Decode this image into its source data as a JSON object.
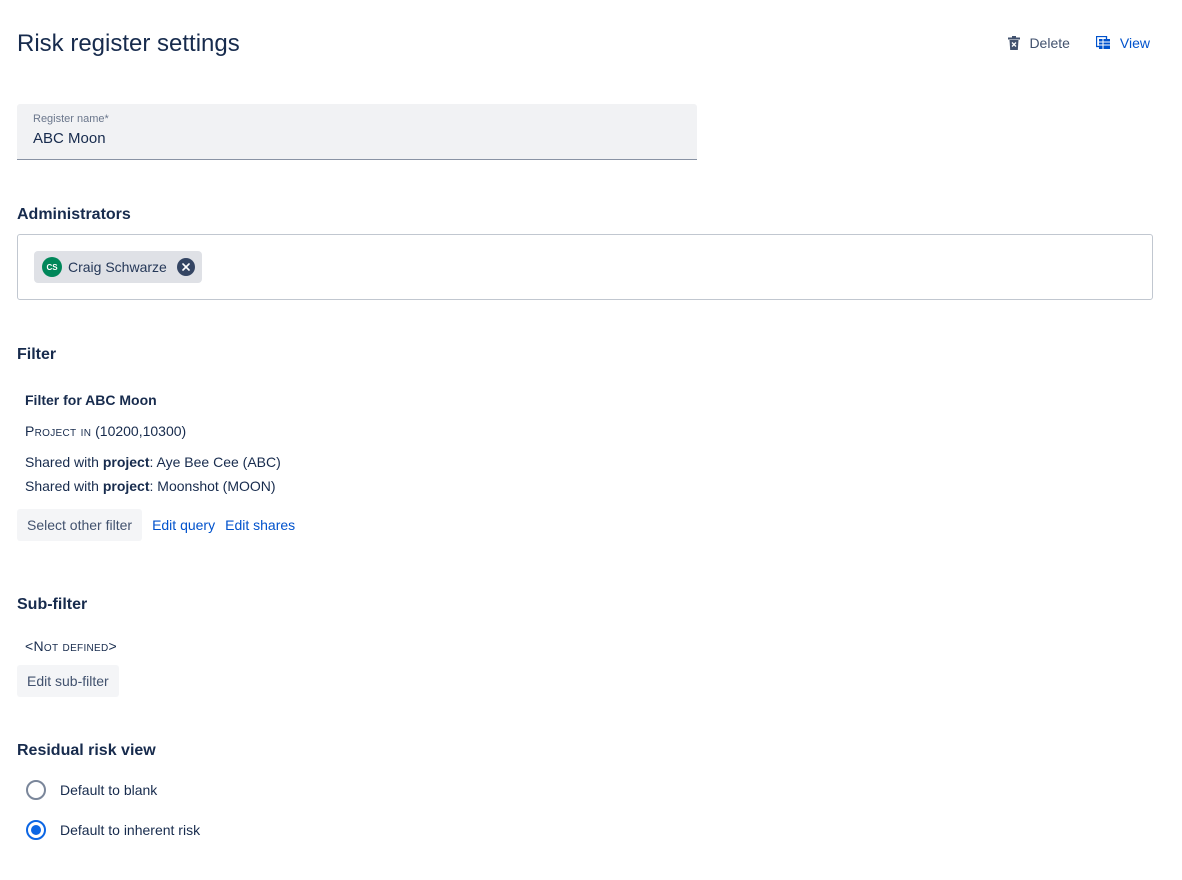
{
  "header": {
    "title": "Risk register settings",
    "delete_label": "Delete",
    "view_label": "View"
  },
  "register_name": {
    "label": "Register name*",
    "value": "ABC Moon"
  },
  "administrators": {
    "heading": "Administrators",
    "users": [
      {
        "initials": "CS",
        "name": "Craig Schwarze",
        "avatar_color": "#00875a"
      }
    ]
  },
  "filter": {
    "heading": "Filter",
    "name": "Filter for ABC Moon",
    "query_keyword": "Project in",
    "query_values": "(10200,10300)",
    "shares": [
      {
        "prefix": "Shared with ",
        "type": "project",
        "target": "Aye Bee Cee (ABC)"
      },
      {
        "prefix": "Shared with ",
        "type": "project",
        "target": "Moonshot (MOON)"
      }
    ],
    "select_other_label": "Select other filter",
    "edit_query_label": "Edit query",
    "edit_shares_label": "Edit shares"
  },
  "subfilter": {
    "heading": "Sub-filter",
    "value": "<Not defined>",
    "edit_label": "Edit sub-filter"
  },
  "residual": {
    "heading": "Residual risk view",
    "options": [
      {
        "label": "Default to blank",
        "checked": false
      },
      {
        "label": "Default to inherent risk",
        "checked": true
      }
    ]
  },
  "colors": {
    "link": "#0052cc",
    "radio_selected": "#0c66e4",
    "text": "#172b4d"
  },
  "icons": {
    "delete": "trash-icon",
    "view": "table-view-icon",
    "remove_chip": "close-circle-icon"
  }
}
